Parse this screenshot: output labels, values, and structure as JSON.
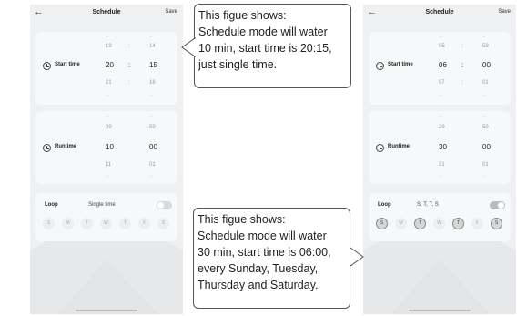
{
  "screens": {
    "left": {
      "header": {
        "back": "←",
        "title": "Schedule",
        "save": "Save"
      },
      "start_time": {
        "label": "Start time",
        "faint_top": [
          "--",
          "--"
        ],
        "above": [
          "19",
          "14"
        ],
        "hour": "20",
        "sep": ":",
        "minute": "15",
        "below": [
          "21",
          "16"
        ],
        "faint_bottom": [
          "--",
          "--"
        ]
      },
      "runtime": {
        "label": "Runtime",
        "faint_top": [
          "--",
          "--"
        ],
        "above": [
          "09",
          "59"
        ],
        "hour": "10",
        "minute": "00",
        "below": [
          "11",
          "01"
        ],
        "faint_bottom": [
          "--",
          "--"
        ]
      },
      "loop": {
        "label": "Loop",
        "value": "Single time",
        "toggle_on": false,
        "days": [
          {
            "letter": "S",
            "selected": false
          },
          {
            "letter": "M",
            "selected": false
          },
          {
            "letter": "T",
            "selected": false
          },
          {
            "letter": "W",
            "selected": false
          },
          {
            "letter": "T",
            "selected": false
          },
          {
            "letter": "F",
            "selected": false
          },
          {
            "letter": "S",
            "selected": false
          }
        ]
      }
    },
    "right": {
      "header": {
        "back": "←",
        "title": "Schedule",
        "save": "Save"
      },
      "start_time": {
        "label": "Start time",
        "faint_top": [
          "--",
          "--"
        ],
        "above": [
          "05",
          "59"
        ],
        "hour": "06",
        "sep": ":",
        "minute": "00",
        "below": [
          "07",
          "01"
        ],
        "faint_bottom": [
          "--",
          "--"
        ]
      },
      "runtime": {
        "label": "Runtime",
        "faint_top": [
          "--",
          "--"
        ],
        "above": [
          "29",
          "59"
        ],
        "hour": "30",
        "minute": "00",
        "below": [
          "31",
          "01"
        ],
        "faint_bottom": [
          "--",
          "--"
        ]
      },
      "loop": {
        "label": "Loop",
        "value": "S, T, T, S",
        "toggle_on": true,
        "days": [
          {
            "letter": "S",
            "selected": true
          },
          {
            "letter": "M",
            "selected": false
          },
          {
            "letter": "T",
            "selected": true
          },
          {
            "letter": "W",
            "selected": false
          },
          {
            "letter": "T",
            "selected": true
          },
          {
            "letter": "F",
            "selected": false
          },
          {
            "letter": "S",
            "selected": true
          }
        ]
      }
    }
  },
  "callouts": {
    "first": [
      "This figue shows:",
      "Schedule mode will water",
      "10 min, start time is 20:15,",
      "just single time."
    ],
    "second": [
      "This figue shows:",
      "Schedule mode will water",
      "30 min, start time is 06:00,",
      "every Sunday, Tuesday,",
      "Thursday and Saturday."
    ]
  }
}
